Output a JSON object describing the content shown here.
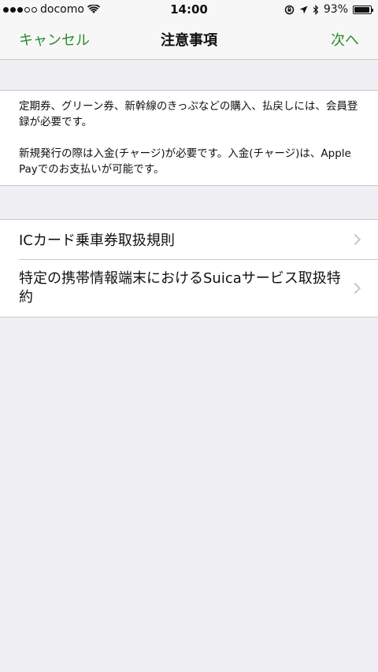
{
  "status": {
    "carrier": "docomo",
    "time": "14:00",
    "battery": "93%",
    "battery_level": 0.93
  },
  "nav": {
    "cancel": "キャンセル",
    "title": "注意事項",
    "next": "次へ"
  },
  "notice": {
    "p1": "定期券、グリーン券、新幹線のきっぷなどの購入、払戻しには、会員登録が必要です。",
    "p2": "新規発行の際は入金(チャージ)が必要です。入金(チャージ)は、Apple Payでのお支払いが可能です。"
  },
  "list": {
    "items": [
      {
        "label": "ICカード乗車券取扱規則"
      },
      {
        "label": "特定の携帯情報端末におけるSuicaサービス取扱特約"
      }
    ]
  },
  "colors": {
    "accent": "#2c8a2f",
    "background": "#efeff4"
  },
  "icons": [
    "wifi-icon",
    "lock-rotation-icon",
    "location-arrow-icon",
    "bluetooth-icon",
    "battery-icon",
    "chevron-right-icon"
  ]
}
